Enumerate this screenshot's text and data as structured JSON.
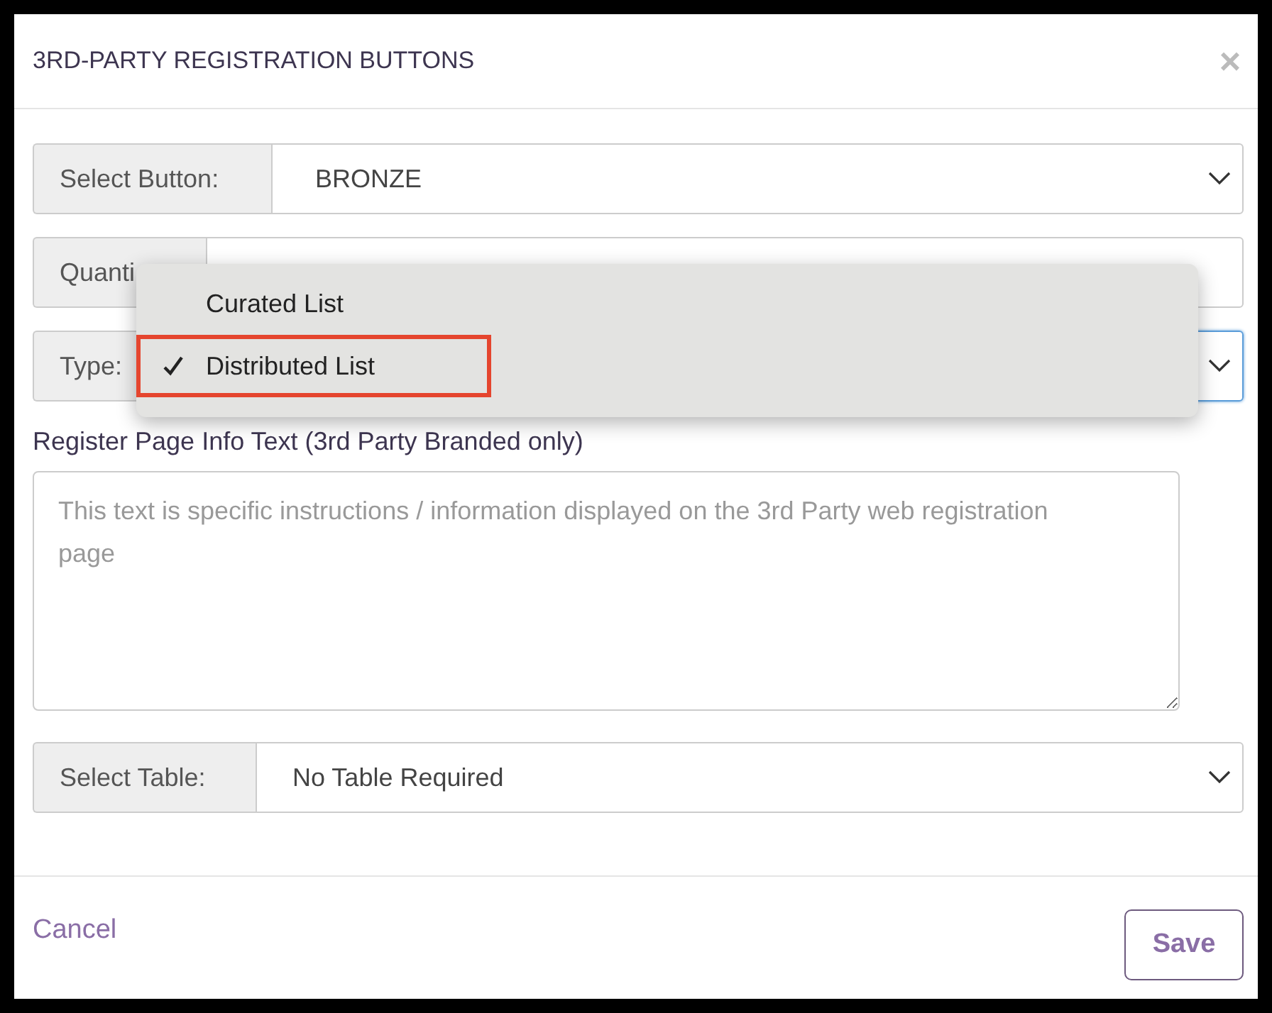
{
  "dialog": {
    "title": "3RD-PARTY REGISTRATION BUTTONS",
    "close": "×"
  },
  "fields": [
    {
      "kind": "select",
      "label": "Select Button:",
      "value": "BRONZE",
      "focused": false
    },
    {
      "kind": "input",
      "label": "Quanti",
      "focused": false
    },
    {
      "kind": "select",
      "label": "Type:",
      "focused": true
    }
  ],
  "menu": {
    "items": [
      {
        "label": "Curated List",
        "selected": false,
        "highlighted": false
      },
      {
        "label": "Distributed List",
        "selected": true,
        "highlighted": true
      }
    ]
  },
  "info": {
    "label": "Register Page Info Text (3rd Party Branded only)",
    "placeholder": "This text is specific instructions / information displayed on the 3rd Party web registration page"
  },
  "table_select": {
    "label": "Select Table:",
    "value": "No Table Required"
  },
  "footer": {
    "cancel": "Cancel",
    "save": "Save"
  }
}
